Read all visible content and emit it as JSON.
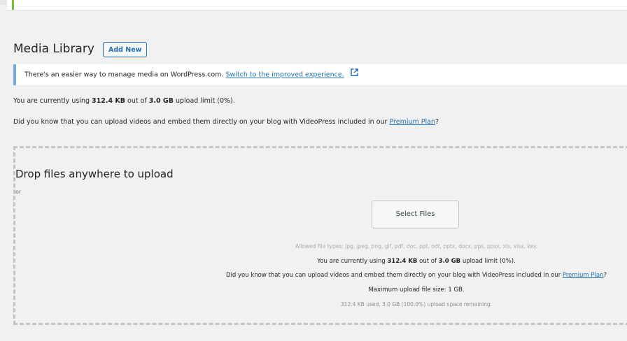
{
  "header": {
    "title": "Media Library",
    "add_new_label": "Add New"
  },
  "notice": {
    "text": "There's an easier way to manage media on WordPress.com. ",
    "link_label": "Switch to the improved experience.",
    "icon": "external-link-icon"
  },
  "usage": {
    "prefix": "You are currently using ",
    "used": "312.4 KB",
    "middle": " out of ",
    "limit": "3.0 GB",
    "suffix": " upload limit (0%)."
  },
  "promo": {
    "text": "Did you know that you can upload videos and embed them directly on your blog with VideoPress included in our ",
    "link_label": "Premium Plan",
    "suffix": "?"
  },
  "dropzone": {
    "title": "Drop files anywhere to upload",
    "or": "or",
    "select_files_label": "Select Files",
    "allowed_types": "Allowed file types: jpg, jpeg, png, gif, pdf, doc, ppt, odt, pptx, docx, pps, ppsx, xls, xlsx, key.",
    "max_size": "Maximum upload file size: 1 GB.",
    "space_remaining": "312.4 KB used, 3.0 GB (100.0%) upload space remaining."
  },
  "colors": {
    "accent": "#2271b1",
    "notice_border": "#72aee6",
    "green_bar": "#72c32e",
    "background": "#f1f1f1"
  }
}
